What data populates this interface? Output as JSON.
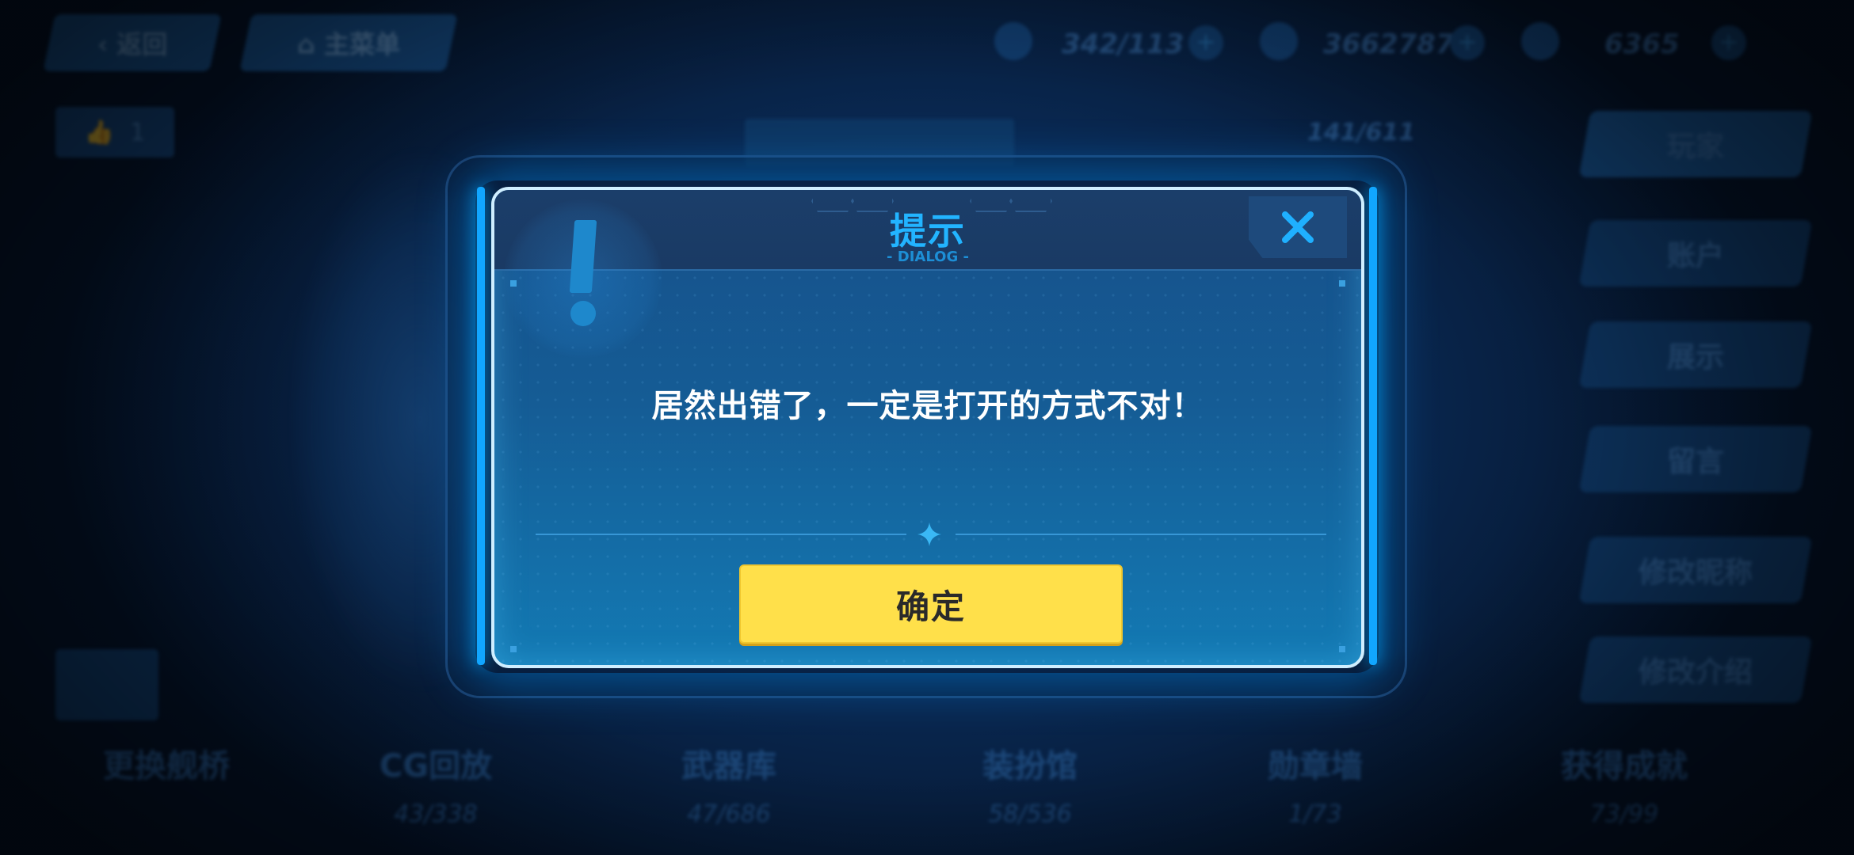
{
  "top_bar": {
    "back_label": "返回",
    "main_menu_label": "主菜单",
    "resources": [
      "342/113",
      "3662787",
      "6365"
    ]
  },
  "like_count": "1",
  "side_menu": {
    "items": [
      "玩家",
      "账户",
      "展示",
      "留言"
    ],
    "rename_label": "修改昵称",
    "edit_intro_label": "修改介绍"
  },
  "stats": [
    {
      "label": "更换舰桥",
      "value": ""
    },
    {
      "label": "CG回放",
      "value": "43/338"
    },
    {
      "label": "武器库",
      "value": "47/686"
    },
    {
      "label": "装扮馆",
      "value": "58/536"
    },
    {
      "label": "勋章墙",
      "value": "1/73"
    },
    {
      "label": "获得成就",
      "value": "73/99"
    }
  ],
  "background_counter": "141/611",
  "dialog": {
    "title": "提示",
    "subtitle": "- DIALOG -",
    "message": "居然出错了，一定是打开的方式不对！",
    "confirm_label": "确定"
  },
  "colors": {
    "dialog_title": "#22b4ff",
    "confirm_button": "#ffe04a",
    "dialog_border": "#cfeeff",
    "glow_bar": "#11a6ff"
  }
}
